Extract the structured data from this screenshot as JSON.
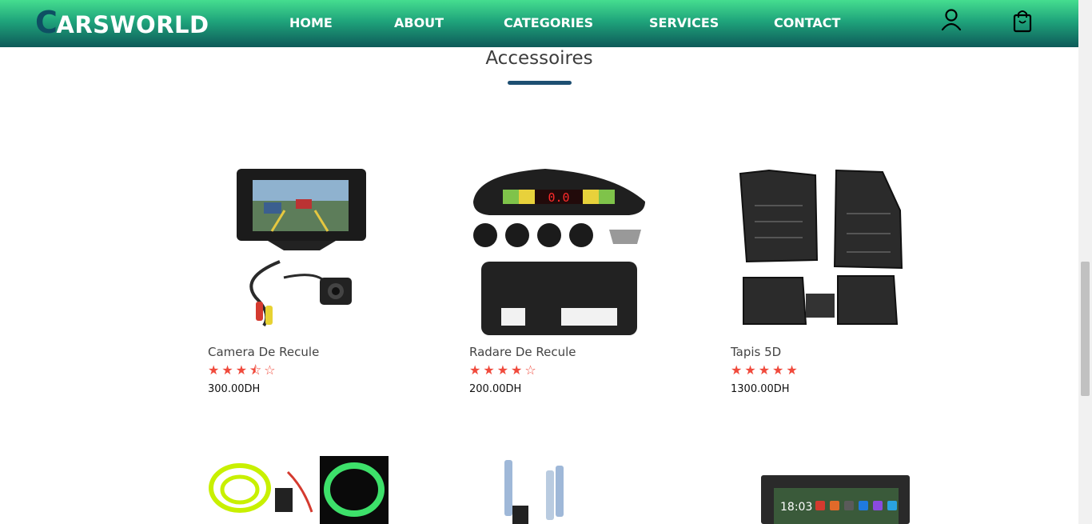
{
  "brand": {
    "first_letter": "C",
    "rest": "ARSWORLD"
  },
  "nav": {
    "home": "HOME",
    "about": "ABOUT",
    "categories": "CATEGORIES",
    "services": "SERVICES",
    "contact": "CONTACT"
  },
  "header_icons": [
    "user-icon",
    "shopping-bag-icon"
  ],
  "section": {
    "title": "Accessoires"
  },
  "products": [
    {
      "name": "Camera De Recule",
      "price": "300.00DH",
      "rating": 3.5,
      "image": "rear-camera-monitor"
    },
    {
      "name": "Radare De Recule",
      "price": "200.00DH",
      "rating": 4,
      "image": "parking-radar-sensors"
    },
    {
      "name": "Tapis 5D",
      "price": "1300.00DH",
      "rating": 5,
      "image": "car-floor-mats"
    },
    {
      "name": "",
      "price": "",
      "rating": null,
      "image": "el-wire-neon-kit"
    },
    {
      "name": "",
      "price": "",
      "rating": null,
      "image": "xenon-bulbs"
    },
    {
      "name": "",
      "price": "",
      "rating": null,
      "image": "android-car-radio"
    }
  ],
  "colors": {
    "accent": "#1e4f72",
    "star": "#f04a3c",
    "header_top": "#45dd8f",
    "header_bottom": "#0e5a59"
  }
}
